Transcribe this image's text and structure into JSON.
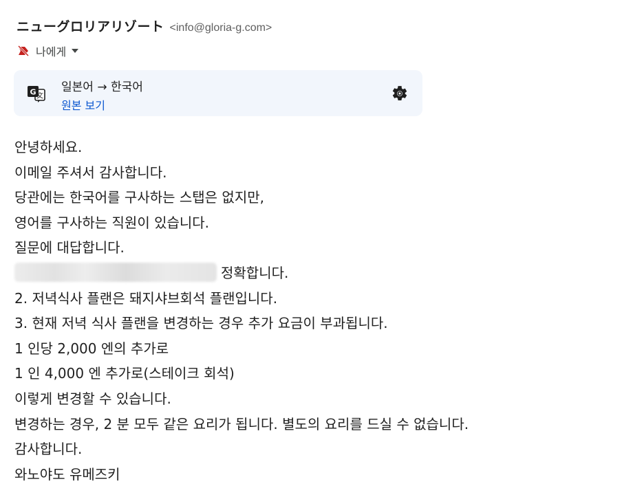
{
  "email": {
    "sender_name": "ニューグロリアリゾート",
    "sender_email": "<info@gloria-g.com>",
    "recipient": "나에게",
    "label_icon": "important-label-icon",
    "caret_icon": "chevron-down-icon"
  },
  "translation": {
    "icon": "google-translate-icon",
    "languages": "일본어 → 한국어",
    "view_original": "원본 보기",
    "settings_icon": "gear-icon"
  },
  "body": {
    "lines": [
      "안녕하세요.",
      "이메일 주셔서 감사합니다.",
      "당관에는 한국어를 구사하는 스탭은 없지만,",
      "영어를 구사하는 직원이 있습니다.",
      "질문에 대답합니다.",
      "정확합니다.",
      "2. 저녁식사 플랜은 돼지샤브회석 플랜입니다.",
      "3. 현재 저녁 식사 플랜을 변경하는 경우 추가 요금이 부과됩니다.",
      "1 인당 2,000 엔의 추가로",
      "1 인 4,000 엔 추가로(스테이크 회석)",
      "이렇게 변경할 수 있습니다.",
      "변경하는 경우, 2 분 모두 같은 요리가 됩니다. 별도의 요리를 드실 수 없습니다.",
      "감사합니다.",
      "와노야도 유메즈키"
    ]
  },
  "colors": {
    "label_icon": "#c5221f",
    "link": "#0b57d0",
    "translate_bar_bg": "#f2f6fc"
  }
}
